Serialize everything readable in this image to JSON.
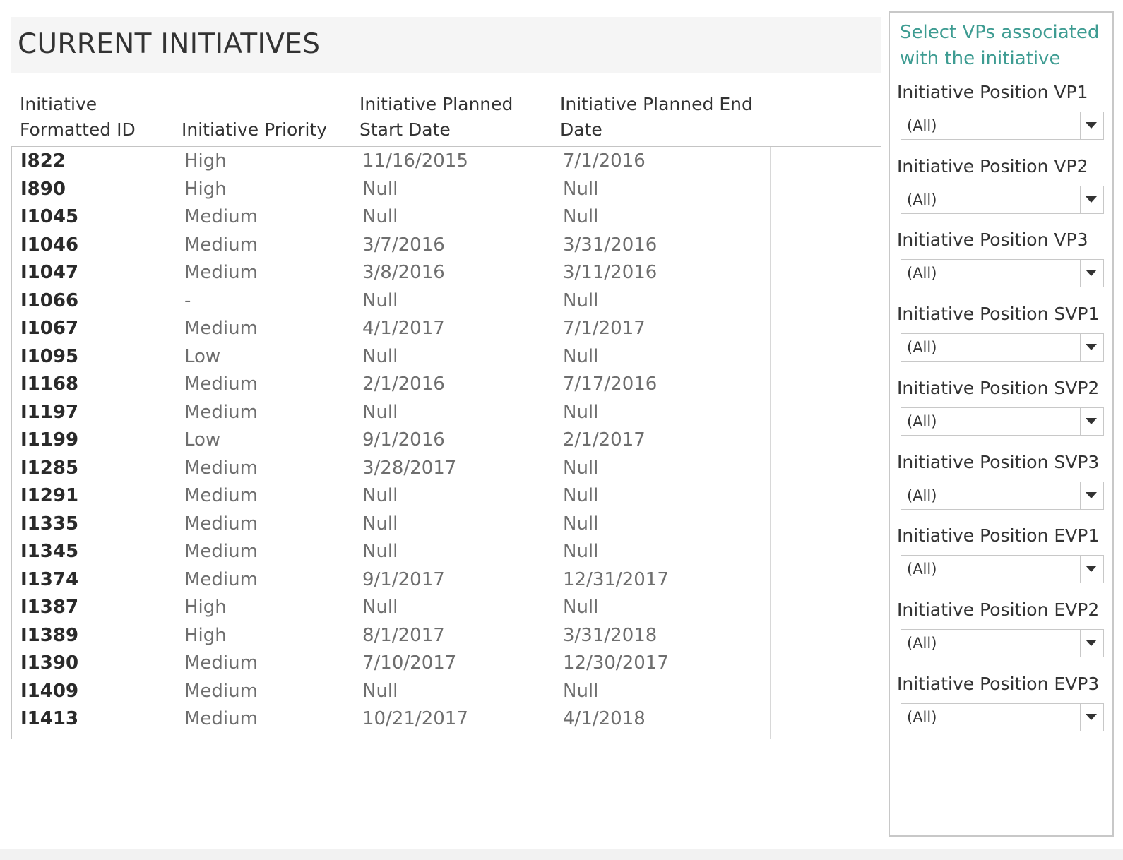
{
  "title": "CURRENT INITIATIVES",
  "table": {
    "headers": {
      "id": [
        "Initiative",
        "Formatted ID"
      ],
      "priority": "Initiative Priority",
      "start": [
        "Initiative Planned",
        "Start Date"
      ],
      "end": [
        "Initiative Planned End",
        "Date"
      ]
    },
    "rows": [
      {
        "id": "I822",
        "priority": "High",
        "start": "11/16/2015",
        "end": "7/1/2016"
      },
      {
        "id": "I890",
        "priority": "High",
        "start": "Null",
        "end": "Null"
      },
      {
        "id": "I1045",
        "priority": "Medium",
        "start": "Null",
        "end": "Null"
      },
      {
        "id": "I1046",
        "priority": "Medium",
        "start": "3/7/2016",
        "end": "3/31/2016"
      },
      {
        "id": "I1047",
        "priority": "Medium",
        "start": "3/8/2016",
        "end": "3/11/2016"
      },
      {
        "id": "I1066",
        "priority": "-",
        "start": "Null",
        "end": "Null"
      },
      {
        "id": "I1067",
        "priority": "Medium",
        "start": "4/1/2017",
        "end": "7/1/2017"
      },
      {
        "id": "I1095",
        "priority": "Low",
        "start": "Null",
        "end": "Null"
      },
      {
        "id": "I1168",
        "priority": "Medium",
        "start": "2/1/2016",
        "end": "7/17/2016"
      },
      {
        "id": "I1197",
        "priority": "Medium",
        "start": "Null",
        "end": "Null"
      },
      {
        "id": "I1199",
        "priority": "Low",
        "start": "9/1/2016",
        "end": "2/1/2017"
      },
      {
        "id": "I1285",
        "priority": "Medium",
        "start": "3/28/2017",
        "end": "Null"
      },
      {
        "id": "I1291",
        "priority": "Medium",
        "start": "Null",
        "end": "Null"
      },
      {
        "id": "I1335",
        "priority": "Medium",
        "start": "Null",
        "end": "Null"
      },
      {
        "id": "I1345",
        "priority": "Medium",
        "start": "Null",
        "end": "Null"
      },
      {
        "id": "I1374",
        "priority": "Medium",
        "start": "9/1/2017",
        "end": "12/31/2017"
      },
      {
        "id": "I1387",
        "priority": "High",
        "start": "Null",
        "end": "Null"
      },
      {
        "id": "I1389",
        "priority": "High",
        "start": "8/1/2017",
        "end": "3/31/2018"
      },
      {
        "id": "I1390",
        "priority": "Medium",
        "start": "7/10/2017",
        "end": "12/30/2017"
      },
      {
        "id": "I1409",
        "priority": "Medium",
        "start": "Null",
        "end": "Null"
      },
      {
        "id": "I1413",
        "priority": "Medium",
        "start": "10/21/2017",
        "end": "4/1/2018"
      }
    ]
  },
  "filters": {
    "title": "Select VPs associated with the initiative",
    "items": [
      {
        "label": "Initiative Position VP1",
        "value": "(All)"
      },
      {
        "label": "Initiative Position VP2",
        "value": "(All)"
      },
      {
        "label": "Initiative Position VP3",
        "value": "(All)"
      },
      {
        "label": "Initiative Position SVP1",
        "value": "(All)"
      },
      {
        "label": "Initiative Position SVP2",
        "value": "(All)"
      },
      {
        "label": "Initiative Position SVP3",
        "value": "(All)"
      },
      {
        "label": "Initiative Position EVP1",
        "value": "(All)"
      },
      {
        "label": "Initiative Position EVP2",
        "value": "(All)"
      },
      {
        "label": "Initiative Position EVP3",
        "value": "(All)"
      }
    ]
  },
  "colors": {
    "accent": "#3e9c92",
    "title_bg": "#f5f5f5",
    "border": "#c8c8c8"
  }
}
